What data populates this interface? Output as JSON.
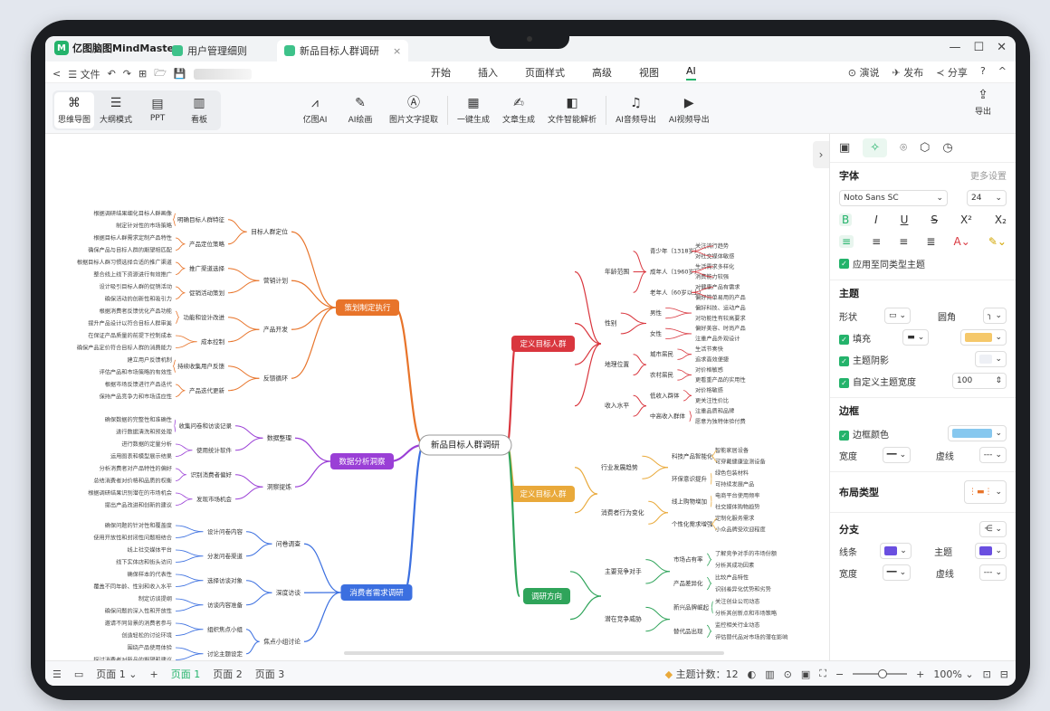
{
  "app": {
    "name": "亿图脑图MindMaster",
    "logo_letter": "M"
  },
  "tabs": [
    {
      "label": "用户管理细则",
      "active": false
    },
    {
      "label": "新品目标人群调研",
      "active": true,
      "close": "×"
    }
  ],
  "window_controls": {
    "minimize": "—",
    "maximize": "☐",
    "close": "✕"
  },
  "menubar": {
    "back": "<",
    "file": "☰ 文件",
    "undo": "↶",
    "redo": "↷",
    "new": "⊞",
    "open": "🗁",
    "save": "💾",
    "center": [
      "开始",
      "插入",
      "页面样式",
      "高级",
      "视图",
      "AI"
    ],
    "active": "AI",
    "right": [
      "⊙ 演说",
      "✈ 发布",
      "≺ 分享",
      "? ",
      "^"
    ]
  },
  "toolbar": {
    "views": [
      {
        "icon": "⌘",
        "label": "思维导图"
      },
      {
        "icon": "☰",
        "label": "大纲模式"
      },
      {
        "icon": "▤",
        "label": "PPT"
      },
      {
        "icon": "▥",
        "label": "看板"
      }
    ],
    "ai_tools": [
      {
        "icon": "⩘",
        "label": "亿图AI"
      },
      {
        "icon": "✎",
        "label": "AI绘画"
      },
      {
        "icon": "Ⓐ",
        "label": "图片文字提取"
      },
      {
        "icon": "▦",
        "label": "一键生成"
      },
      {
        "icon": "✍",
        "label": "文章生成"
      },
      {
        "icon": "◧",
        "label": "文件智能解析"
      },
      {
        "icon": "♫",
        "label": "AI音频导出"
      },
      {
        "icon": "▶",
        "label": "AI视频导出"
      }
    ],
    "export": {
      "icon": "⇪",
      "label": "导出"
    }
  },
  "mindmap": {
    "root": "新品目标人群调研",
    "branches": [
      {
        "label": "策划制定执行",
        "color": "#e8742a",
        "subs": [
          {
            "label": "目标人群定位",
            "items": [
              {
                "label": "明确目标人群特征",
                "leaves": [
                  "根据调研结果细化目标人群画像",
                  "制定针对性的市场策略"
                ]
              },
              {
                "label": "产品定位策略",
                "leaves": [
                  "根据目标人群需求定制产品特性",
                  "确保产品与目标人群的期望相匹配"
                ]
              }
            ]
          },
          {
            "label": "营销计划",
            "items": [
              {
                "label": "推广渠道选择",
                "leaves": [
                  "根据目标人群习惯选择合适的推广渠道",
                  "整合线上线下资源进行有效推广"
                ]
              },
              {
                "label": "促销活动策划",
                "leaves": [
                  "设计吸引目标人群的促销活动",
                  "确保活动的创新性和吸引力"
                ]
              }
            ]
          },
          {
            "label": "产品开发",
            "items": [
              {
                "label": "功能和设计改进",
                "leaves": [
                  "根据消费者反馈优化产品功能",
                  "提升产品设计以符合目标人群审美"
                ]
              },
              {
                "label": "成本控制",
                "leaves": [
                  "在保证产品质量的前提下控制成本",
                  "确保产品定价符合目标人群的消费能力"
                ]
              }
            ]
          },
          {
            "label": "反馈循环",
            "items": [
              {
                "label": "持续收集用户反馈",
                "leaves": [
                  "建立用户反馈机制",
                  "评估产品和市场策略的有效性"
                ]
              },
              {
                "label": "产品迭代更新",
                "leaves": [
                  "根据市场反馈进行产品迭代",
                  "保持产品竞争力和市场适应性"
                ]
              }
            ]
          }
        ]
      },
      {
        "label": "数据分析洞察",
        "color": "#9a3fd6",
        "subs": [
          {
            "label": "数据整理",
            "items": [
              {
                "label": "收集问卷和访谈记录",
                "leaves": [
                  "确保数据的完整性和准确性",
                  "进行数据清洗和预处理"
                ]
              },
              {
                "label": "使用统计软件",
                "leaves": [
                  "进行数据的定量分析",
                  "运用图表和模型展示结果"
                ]
              }
            ]
          },
          {
            "label": "洞察提炼",
            "items": [
              {
                "label": "识别消费者偏好",
                "leaves": [
                  "分析消费者对产品特性的偏好",
                  "总结消费者对价格和品质的权衡"
                ]
              },
              {
                "label": "发现市场机会",
                "leaves": [
                  "根据调研结果识别潜在的市场机会",
                  "提出产品改进和创新的建议"
                ]
              }
            ]
          }
        ]
      },
      {
        "label": "消费者需求调研",
        "color": "#3b6fe0",
        "subs": [
          {
            "label": "问卷调查",
            "items": [
              {
                "label": "设计问卷内容",
                "leaves": [
                  "确保问题的针对性和覆盖度",
                  "使用开放性和封闭性问题相结合"
                ]
              },
              {
                "label": "分发问卷渠道",
                "leaves": [
                  "线上社交媒体平台",
                  "线下实体店和街头访问"
                ]
              }
            ]
          },
          {
            "label": "深度访谈",
            "items": [
              {
                "label": "选择访谈对象",
                "leaves": [
                  "确保样本的代表性",
                  "覆盖不同年龄、性别和收入水平"
                ]
              },
              {
                "label": "访谈内容准备",
                "leaves": [
                  "制定访谈提纲",
                  "确保问题的深入性和开放性"
                ]
              }
            ]
          },
          {
            "label": "焦点小组讨论",
            "items": [
              {
                "label": "组织焦点小组",
                "leaves": [
                  "邀请不同背景的消费者参与",
                  "创造轻松的讨论环境"
                ]
              },
              {
                "label": "讨论主题设定",
                "leaves": [
                  "围绕产品使用体验",
                  "探讨消费者对新品的期望和建议"
                ]
              }
            ]
          }
        ]
      },
      {
        "label": "定义目标人群",
        "color": "#d9363e",
        "subs": [
          {
            "label": "年龄范围",
            "items": [
              {
                "label": "青少年（1318岁）",
                "leaves": [
                  "关注流行趋势",
                  "对社交媒体敏感"
                ]
              },
              {
                "label": "成年人（1960岁）",
                "leaves": [
                  "生活需求多样化",
                  "消费能力较强"
                ]
              },
              {
                "label": "老年人（60岁以上）",
                "leaves": [
                  "对健康产品有需求",
                  "偏好简单易用的产品"
                ]
              }
            ]
          },
          {
            "label": "性别",
            "items": [
              {
                "label": "男性",
                "leaves": [
                  "偏好科技、运动产品",
                  "对功能性有较高要求"
                ]
              },
              {
                "label": "女性",
                "leaves": [
                  "偏好美容、时尚产品",
                  "注重产品外观设计"
                ]
              }
            ]
          },
          {
            "label": "地理位置",
            "items": [
              {
                "label": "城市居民",
                "leaves": [
                  "生活节奏快",
                  "追求高效便捷"
                ]
              },
              {
                "label": "农村居民",
                "leaves": [
                  "对价格敏感",
                  "更看重产品的实用性"
                ]
              }
            ]
          },
          {
            "label": "收入水平",
            "items": [
              {
                "label": "低收入群体",
                "leaves": [
                  "对价格敏感",
                  "更关注性价比"
                ]
              },
              {
                "label": "中高收入群体",
                "leaves": [
                  "注重品质和品牌",
                  "愿意为独特体验付费"
                ]
              }
            ]
          }
        ]
      },
      {
        "label": "定义目标人群",
        "color": "#e9a93a",
        "subs": [
          {
            "label": "行业发展趋势",
            "items": [
              {
                "label": "科技产品智能化",
                "leaves": [
                  "智能家居设备",
                  "可穿戴健康监测设备"
                ]
              },
              {
                "label": "环保意识提升",
                "leaves": [
                  "绿色包装材料",
                  "可持续发展产品"
                ]
              }
            ]
          },
          {
            "label": "消费者行为变化",
            "items": [
              {
                "label": "线上购物增加",
                "leaves": [
                  "电商平台使用频率",
                  "社交媒体购物趋势"
                ]
              },
              {
                "label": "个性化需求增强",
                "leaves": [
                  "定制化服务需求",
                  "小众品牌受欢迎程度"
                ]
              }
            ]
          }
        ]
      },
      {
        "label": "调研方向",
        "color": "#2fa45a",
        "subs": [
          {
            "label": "主要竞争对手",
            "items": [
              {
                "label": "市场占有率",
                "leaves": [
                  "了解竞争对手的市场份额",
                  "分析其成功因素"
                ]
              },
              {
                "label": "产品差异化",
                "leaves": [
                  "比较产品特性",
                  "识别差异化优势和劣势"
                ]
              }
            ]
          },
          {
            "label": "潜在竞争威胁",
            "items": [
              {
                "label": "新兴品牌崛起",
                "leaves": [
                  "关注创业公司动态",
                  "分析其创新点和市场策略"
                ]
              },
              {
                "label": "替代品出现",
                "leaves": [
                  "监控相关行业动态",
                  "评估替代品对市场的潜在影响"
                ]
              }
            ]
          }
        ]
      }
    ]
  },
  "panel": {
    "tab_icons": [
      "▣",
      "✧",
      "⌾",
      "⬡",
      "◷"
    ],
    "font": {
      "title": "字体",
      "more": "更多设置",
      "family": "Noto Sans SC",
      "size": "24",
      "styles": [
        "B",
        "I",
        "U",
        "S",
        "X²",
        "X₂"
      ],
      "aligns": [
        "≡",
        "≡",
        "≡",
        "≣"
      ],
      "apply": "应用至同类型主题"
    },
    "theme": {
      "title": "主题",
      "shape": "形状",
      "corner": "圆角",
      "fill": "填充",
      "shadow": "主题阴影",
      "width": "自定义主题宽度",
      "width_value": "100",
      "fill_color": "#f5c86a"
    },
    "border": {
      "title": "边框",
      "color": "边框颜色",
      "color_value": "#87c8ef",
      "width": "宽度",
      "dash": "虚线",
      "dash_value": "---"
    },
    "layout": {
      "title": "布局类型"
    },
    "branch": {
      "title": "分支",
      "line": "线条",
      "theme": "主题",
      "width": "宽度",
      "dash": "虚线",
      "line_color": "#6a4fe0",
      "dash_value": "---"
    }
  },
  "statusbar": {
    "page_select": "页面 1",
    "pages": [
      "页面 1",
      "页面 2",
      "页面 3"
    ],
    "topic_count": "主题计数：12",
    "zoom": "100%"
  }
}
